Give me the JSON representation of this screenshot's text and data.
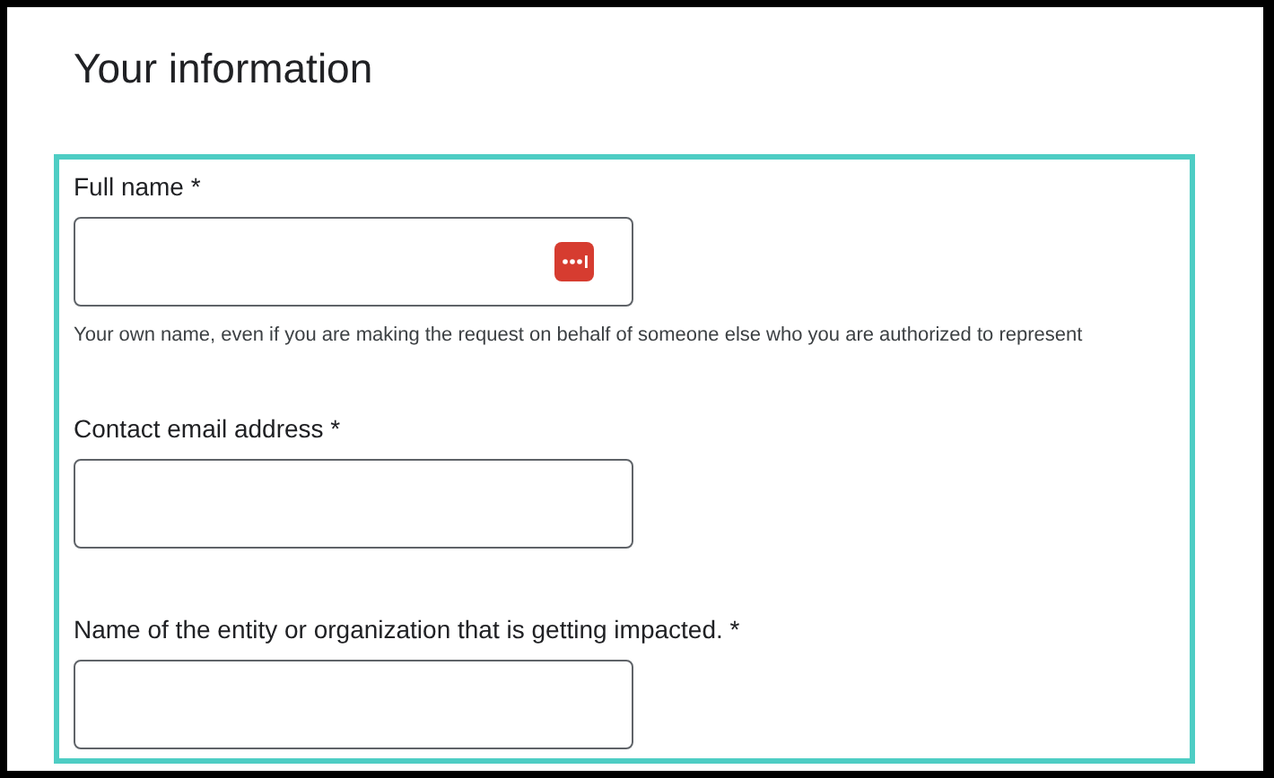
{
  "heading": "Your information",
  "fields": [
    {
      "label": "Full name *",
      "autofill_icon": true,
      "help": "Your own name, even if you are making the request on behalf of someone else who you are authorized to represent"
    },
    {
      "label": "Contact email address *",
      "autofill_icon": false
    },
    {
      "label": "Name of the entity or organization that is getting impacted. *",
      "autofill_icon": false
    }
  ]
}
